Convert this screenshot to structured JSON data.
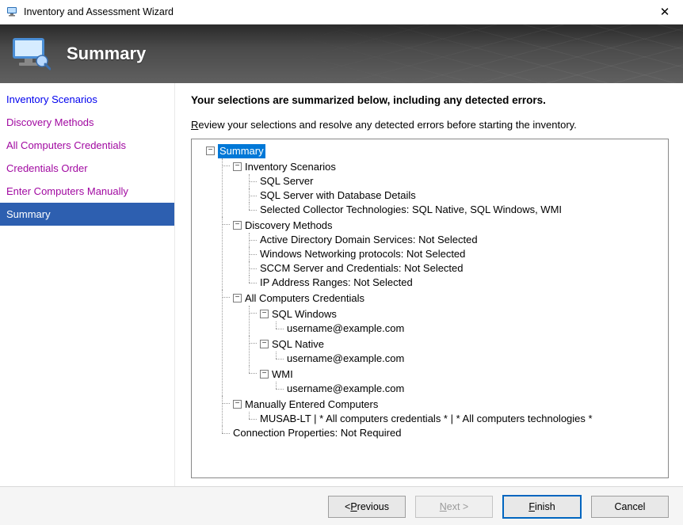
{
  "window": {
    "title": "Inventory and Assessment Wizard",
    "close_glyph": "✕"
  },
  "banner": {
    "title": "Summary"
  },
  "sidebar": {
    "items": [
      {
        "label": "Inventory Scenarios",
        "state": "link"
      },
      {
        "label": "Discovery Methods",
        "state": "visited"
      },
      {
        "label": "All Computers Credentials",
        "state": "visited"
      },
      {
        "label": "Credentials Order",
        "state": "visited"
      },
      {
        "label": "Enter Computers Manually",
        "state": "visited"
      },
      {
        "label": "Summary",
        "state": "current"
      }
    ]
  },
  "content": {
    "headline": "Your selections are summarized below, including any detected errors.",
    "subtext_prefix_accel": "R",
    "subtext_rest": "eview your selections and resolve any detected errors before starting the inventory."
  },
  "tree": {
    "root": {
      "label": "Summary",
      "selected": true,
      "children": [
        {
          "label": "Inventory Scenarios",
          "children": [
            {
              "label": "SQL Server"
            },
            {
              "label": "SQL Server with Database Details"
            },
            {
              "label": "Selected Collector Technologies: SQL Native, SQL Windows, WMI"
            }
          ]
        },
        {
          "label": "Discovery Methods",
          "children": [
            {
              "label": "Active Directory Domain Services: Not Selected"
            },
            {
              "label": "Windows Networking protocols: Not Selected"
            },
            {
              "label": "SCCM Server and Credentials: Not Selected"
            },
            {
              "label": "IP Address Ranges: Not Selected"
            }
          ]
        },
        {
          "label": "All Computers Credentials",
          "children": [
            {
              "label": "SQL Windows",
              "children": [
                {
                  "label": "username@example.com"
                }
              ]
            },
            {
              "label": "SQL Native",
              "children": [
                {
                  "label": "username@example.com"
                }
              ]
            },
            {
              "label": "WMI",
              "children": [
                {
                  "label": "username@example.com"
                }
              ]
            }
          ]
        },
        {
          "label": "Manually Entered Computers",
          "children": [
            {
              "label": "MUSAB-LT | * All computers credentials * | * All computers technologies *"
            }
          ]
        },
        {
          "label": "Connection Properties: Not Required"
        }
      ]
    }
  },
  "buttons": {
    "previous": {
      "prefix": "< ",
      "accel": "P",
      "rest": "revious",
      "enabled": true,
      "primary": false
    },
    "next": {
      "prefix": "",
      "accel": "N",
      "rest": "ext >",
      "enabled": false,
      "primary": false
    },
    "finish": {
      "prefix": "",
      "accel": "F",
      "rest": "inish",
      "enabled": true,
      "primary": true
    },
    "cancel": {
      "prefix": "",
      "accel": "",
      "rest": "Cancel",
      "enabled": true,
      "primary": false
    }
  }
}
